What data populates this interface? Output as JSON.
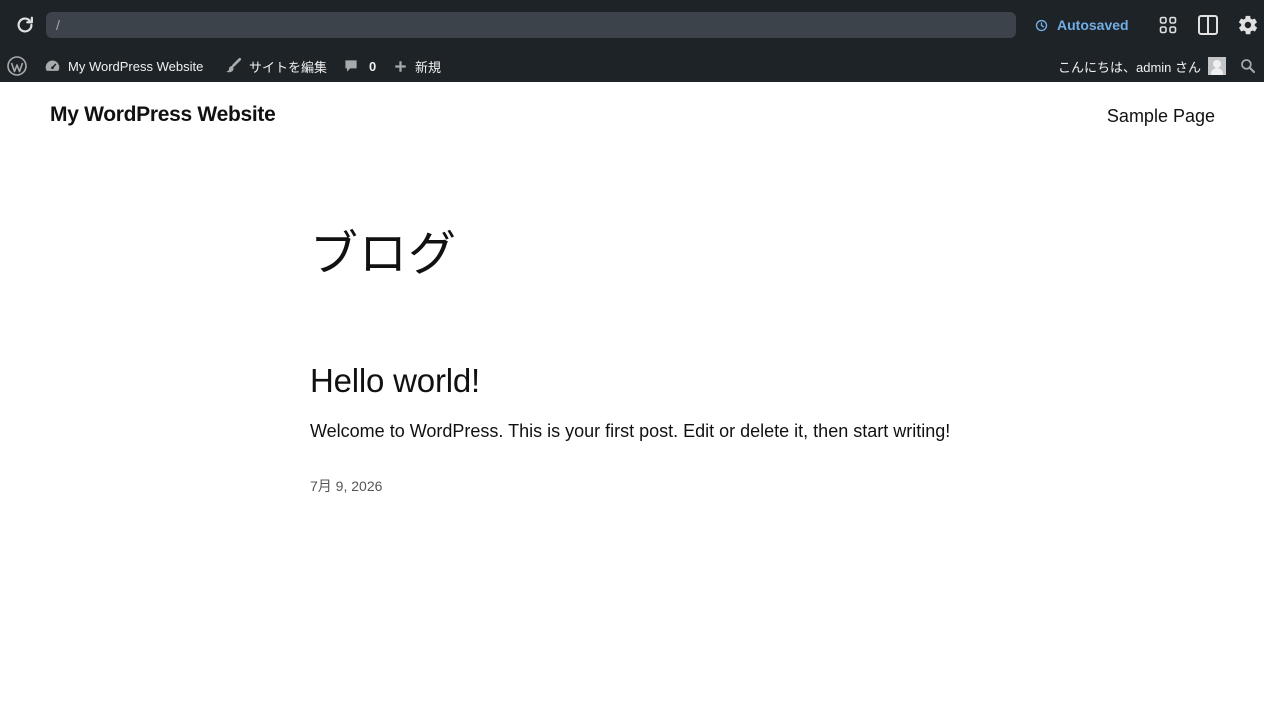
{
  "toolbar": {
    "url_value": "/",
    "autosave_label": "Autosaved",
    "colors": {
      "bar_bg": "#1d2327",
      "url_bg": "#3c434a",
      "autosave_accent": "#72aee6"
    }
  },
  "adminbar": {
    "site_name": "My WordPress Website",
    "edit_site_label": "サイトを編集",
    "comments_count": "0",
    "new_label": "新規",
    "greeting": "こんにちは、admin さん"
  },
  "site": {
    "title": "My WordPress Website",
    "nav": [
      "Sample Page"
    ]
  },
  "main": {
    "heading": "ブログ",
    "posts": [
      {
        "title": "Hello world!",
        "excerpt": "Welcome to WordPress. This is your first post. Edit or delete it, then start writing!",
        "date": "7月 9, 2026"
      }
    ]
  },
  "icons": [
    "reload-icon",
    "history-icon",
    "block-grid-icon",
    "split-view-icon",
    "gear-icon",
    "wordpress-logo-icon",
    "dashboard-icon",
    "brush-icon",
    "comment-icon",
    "plus-icon",
    "avatar",
    "search-icon"
  ]
}
